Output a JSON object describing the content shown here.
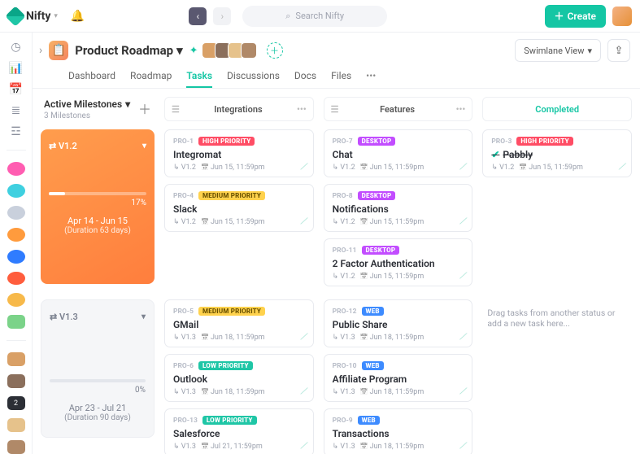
{
  "topbar": {
    "brand": "Nifty",
    "search_placeholder": "Search Nifty",
    "create_label": "Create"
  },
  "project": {
    "title": "Product Roadmap",
    "tabs": [
      "Dashboard",
      "Roadmap",
      "Tasks",
      "Discussions",
      "Docs",
      "Files"
    ],
    "active_tab": "Tasks",
    "view": "Swimlane View"
  },
  "board": {
    "milestone_header": "Active Milestones",
    "milestone_sub": "3 Milestones",
    "columns": [
      "Integrations",
      "Features",
      "Completed"
    ],
    "lanes": [
      {
        "version": "V1.2",
        "style": "orange",
        "progress_pct": 17,
        "range": "Apr 14 - Jun 15",
        "duration": "(Duration 63 days)",
        "cols": [
          [
            {
              "id": "PRO-1",
              "pill": "HIGH PRIORITY",
              "pill_cls": "high",
              "title": "Integromat",
              "ver": "V1.2",
              "due": "Jun 15, 11:59pm"
            },
            {
              "id": "PRO-4",
              "pill": "MEDIUM PRIORITY",
              "pill_cls": "med",
              "title": "Slack",
              "ver": "V1.2",
              "due": "Jun 15, 11:59pm"
            }
          ],
          [
            {
              "id": "PRO-7",
              "pill": "DESKTOP",
              "pill_cls": "desk",
              "title": "Chat",
              "ver": "V1.2",
              "due": "Jun 15, 11:59pm"
            },
            {
              "id": "PRO-8",
              "pill": "DESKTOP",
              "pill_cls": "desk",
              "title": "Notifications",
              "ver": "V1.2",
              "due": "Jun 15, 11:59pm"
            },
            {
              "id": "PRO-11",
              "pill": "DESKTOP",
              "pill_cls": "desk",
              "title": "2 Factor Authentication",
              "ver": "V1.2",
              "due": "Jun 15, 11:59pm"
            }
          ],
          [
            {
              "id": "PRO-3",
              "pill": "HIGH PRIORITY",
              "pill_cls": "high",
              "title": "Pabbly",
              "ver": "V1.2",
              "due": "Jun 15, 11:59pm",
              "done": true
            }
          ]
        ]
      },
      {
        "version": "V1.3",
        "style": "gray",
        "progress_pct": 0,
        "range": "Apr 23 - Jul 21",
        "duration": "(Duration 90 days)",
        "cols": [
          [
            {
              "id": "PRO-5",
              "pill": "MEDIUM PRIORITY",
              "pill_cls": "med",
              "title": "GMail",
              "ver": "V1.3",
              "due": "Jun 18, 11:59pm"
            },
            {
              "id": "PRO-6",
              "pill": "LOW PRIORITY",
              "pill_cls": "low",
              "title": "Outlook",
              "ver": "V1.3",
              "due": "Jun 18, 11:59pm"
            },
            {
              "id": "PRO-13",
              "pill": "LOW PRIORITY",
              "pill_cls": "low",
              "title": "Salesforce",
              "ver": "V1.3",
              "due": "Jul 21, 11:59pm"
            }
          ],
          [
            {
              "id": "PRO-12",
              "pill": "WEB",
              "pill_cls": "web",
              "title": "Public Share",
              "ver": "V1.3",
              "due": "Jun 18, 11:59pm"
            },
            {
              "id": "PRO-10",
              "pill": "WEB",
              "pill_cls": "web",
              "title": "Affiliate Program",
              "ver": "V1.3",
              "due": "Jun 18, 11:59pm"
            },
            {
              "id": "PRO-9",
              "pill": "WEB",
              "pill_cls": "web",
              "title": "Transactions",
              "ver": "V1.3",
              "due": "Jun 18, 11:59pm"
            }
          ],
          [
            {
              "empty": "Drag tasks from another status or add a new task here..."
            }
          ]
        ]
      }
    ]
  }
}
